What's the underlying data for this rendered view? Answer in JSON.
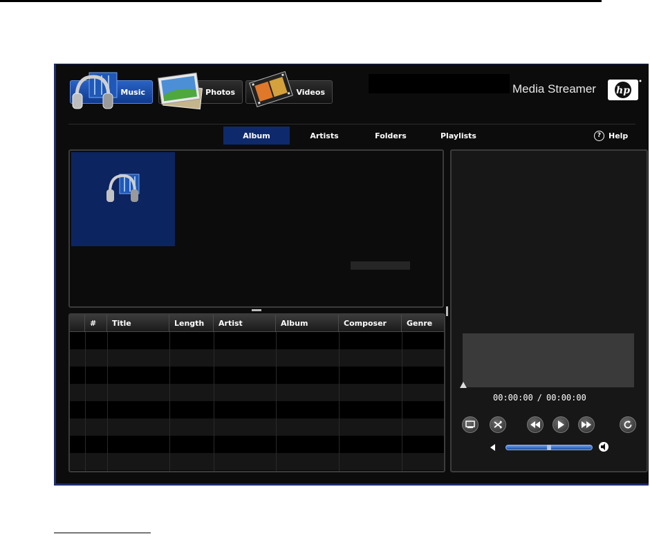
{
  "app": {
    "brand": "Media Streamer",
    "logo": "hp"
  },
  "media_tabs": [
    {
      "label": "Music",
      "icon": "headphones-icon",
      "active": true
    },
    {
      "label": "Photos",
      "icon": "photos-icon",
      "active": false
    },
    {
      "label": "Videos",
      "icon": "film-reel-icon",
      "active": false
    }
  ],
  "subnav": [
    {
      "label": "Album",
      "active": true
    },
    {
      "label": "Artists",
      "active": false
    },
    {
      "label": "Folders",
      "active": false
    },
    {
      "label": "Playlists",
      "active": false
    }
  ],
  "help": {
    "label": "Help",
    "icon_glyph": "?"
  },
  "track_table": {
    "columns": [
      "",
      "#",
      "Title",
      "Length",
      "Artist",
      "Album",
      "Composer",
      "Genre"
    ],
    "rows": []
  },
  "player": {
    "current_time": "00:00:00",
    "separator": "/",
    "total_time": "00:00:00",
    "progress": 0,
    "volume": 0.5,
    "controls": [
      "pip-icon",
      "shuffle-icon",
      "rewind-icon",
      "play-icon",
      "fast-forward-icon",
      "repeat-icon"
    ]
  },
  "colors": {
    "accent": "#2a62c4",
    "active_subnav": "#0e2a6c",
    "album_tile": "#0c2460",
    "background": "#0c0c0c"
  }
}
